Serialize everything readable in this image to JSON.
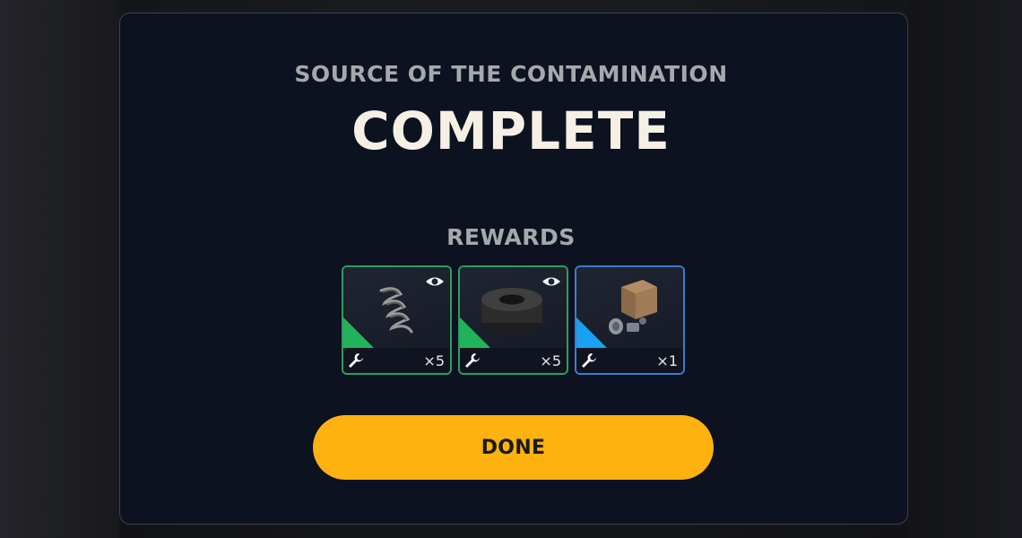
{
  "dialog": {
    "subtitle": "SOURCE OF THE CONTAMINATION",
    "title": "COMPLETE",
    "rewards_label": "REWARDS",
    "done_label": "DONE"
  },
  "rewards": [
    {
      "item": "spring",
      "quantity": "×5",
      "rarity_color": "#21b35c",
      "has_preview": true
    },
    {
      "item": "rubber-ring",
      "quantity": "×5",
      "rarity_color": "#21b35c",
      "has_preview": true
    },
    {
      "item": "crate-with-parts",
      "quantity": "×1",
      "rarity_color": "#1aa0f0",
      "has_preview": false
    }
  ],
  "icons": {
    "preview": "eye-icon",
    "category": "wrench-icon"
  },
  "colors": {
    "panel_bg": "#0d1220",
    "accent_button": "#fdb20f",
    "rarity_uncommon": "#21b35c",
    "rarity_rare": "#1aa0f0",
    "title_text": "#f6efe4"
  }
}
